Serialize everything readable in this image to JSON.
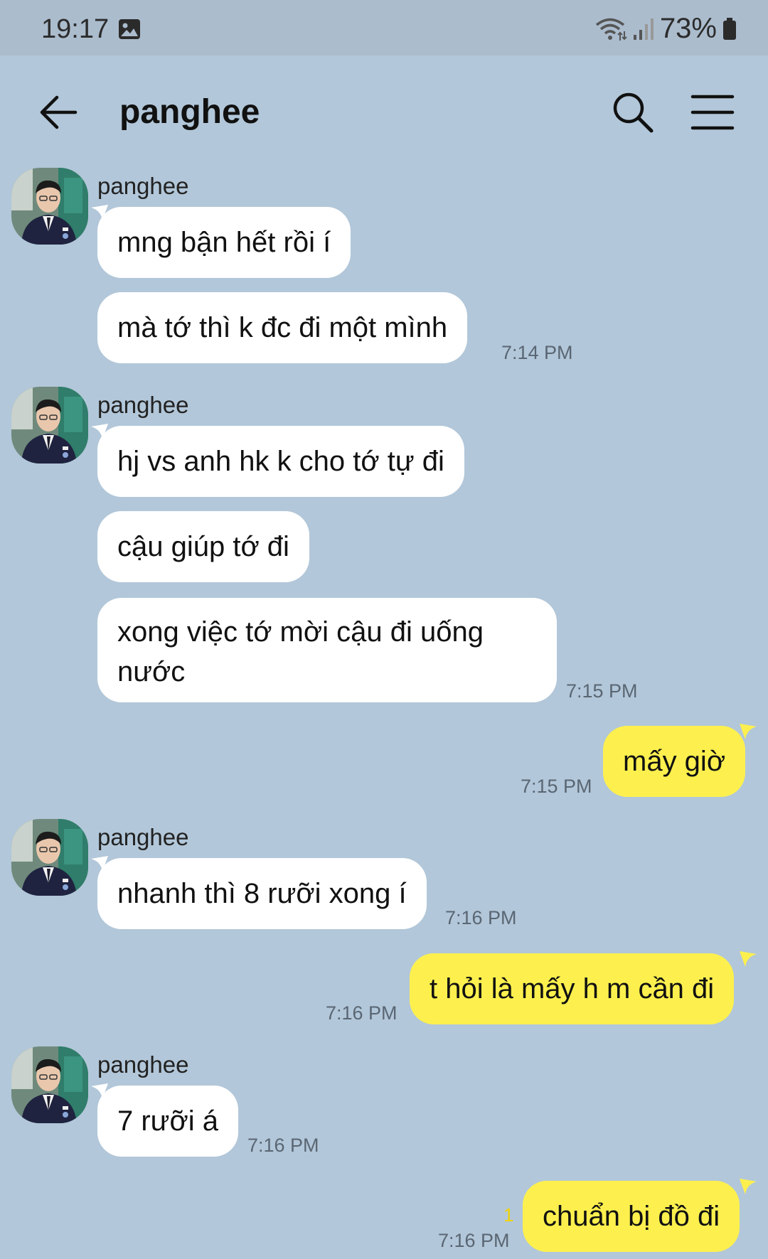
{
  "status_bar": {
    "time": "19:17",
    "battery": "73%"
  },
  "header": {
    "title": "panghee"
  },
  "messages": [
    {
      "sender": "panghee",
      "text": "mng bận hết rồi í"
    },
    {
      "text": "mà tớ thì k đc đi một mình",
      "time": "7:14 PM"
    },
    {
      "sender": "panghee",
      "text": "hj vs anh hk k cho tớ tự đi"
    },
    {
      "text": "cậu giúp tớ đi"
    },
    {
      "text": "xong việc tớ mời cậu đi uống nước",
      "time": "7:15 PM"
    },
    {
      "text": "mấy giờ",
      "time": "7:15 PM"
    },
    {
      "sender": "panghee",
      "text": "nhanh thì 8 rưỡi xong í",
      "time": "7:16 PM"
    },
    {
      "text": "t hỏi là mấy h m cần đi",
      "time": "7:16 PM"
    },
    {
      "sender": "panghee",
      "text": "7 rưỡi á",
      "time": "7:16 PM"
    },
    {
      "text": "chuẩn bị đồ đi",
      "time": "7:16 PM",
      "unread": "1"
    }
  ],
  "colors": {
    "background": "#b2c7d9",
    "incoming": "#ffffff",
    "outgoing": "#fdf04e"
  },
  "icons": [
    "image-icon",
    "wifi-icon",
    "signal-icon",
    "battery-icon",
    "back-arrow-icon",
    "search-icon",
    "menu-icon",
    "avatar"
  ]
}
